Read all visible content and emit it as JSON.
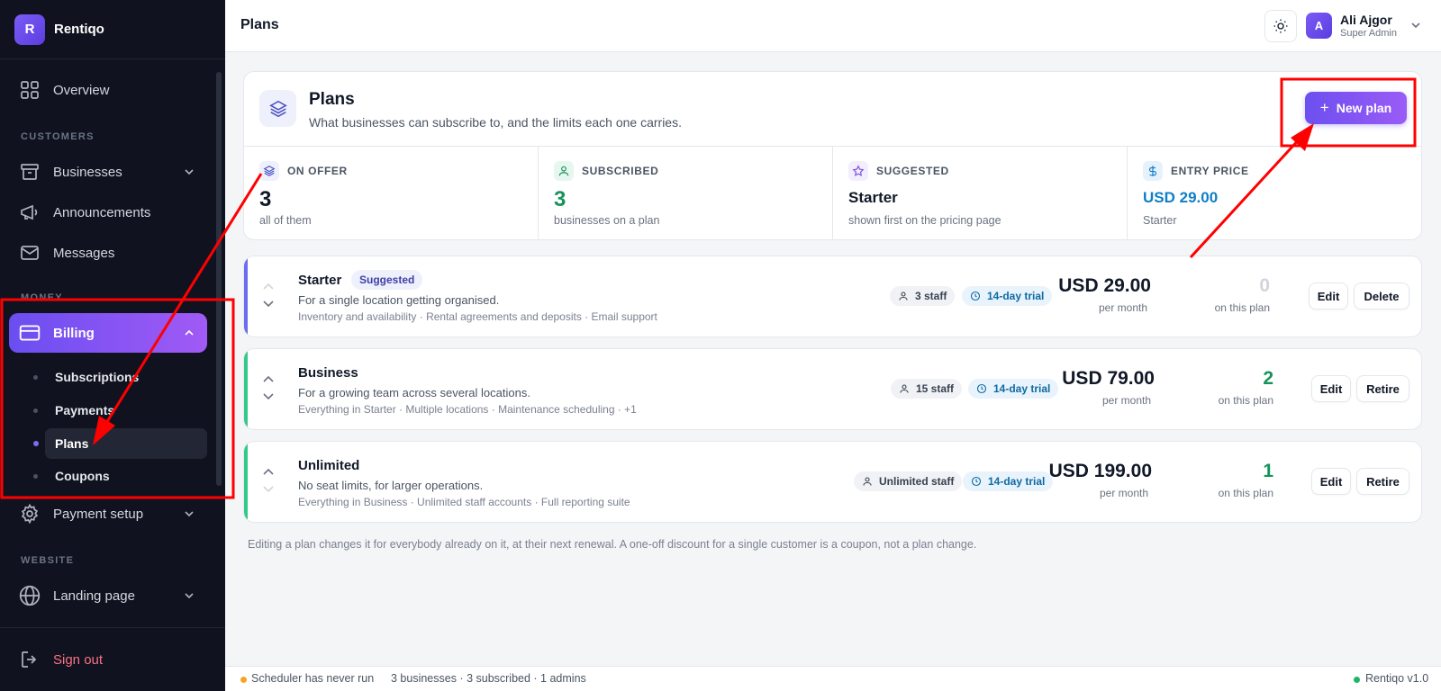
{
  "brand": {
    "logo_letter": "R",
    "name": "Rentiqo"
  },
  "sidebar": {
    "overview": "Overview",
    "section_customers": "CUSTOMERS",
    "businesses": "Businesses",
    "announcements": "Announcements",
    "messages": "Messages",
    "section_money": "MONEY",
    "billing": "Billing",
    "sub_items": [
      "Subscriptions",
      "Payments",
      "Plans",
      "Coupons"
    ],
    "payment_setup": "Payment setup",
    "section_website": "WEBSITE",
    "landing_page": "Landing page",
    "sign_out": "Sign out"
  },
  "topbar": {
    "title": "Plans",
    "user_initial": "A",
    "user_name": "Ali Ajgor",
    "user_role": "Super Admin"
  },
  "header": {
    "title": "Plans",
    "subtitle": "What businesses can subscribe to, and the limits each one carries.",
    "new_plan_label": "New plan"
  },
  "stats": [
    {
      "label": "ON OFFER",
      "value": "3",
      "note": "all of them",
      "icon": "layers-icon"
    },
    {
      "label": "SUBSCRIBED",
      "value": "3",
      "note": "businesses on a plan",
      "icon": "user-icon"
    },
    {
      "label": "SUGGESTED",
      "value": "Starter",
      "note": "shown first on the pricing page",
      "icon": "star-icon"
    },
    {
      "label": "ENTRY PRICE",
      "value": "USD 29.00",
      "note": "Starter",
      "icon": "dollar-icon"
    }
  ],
  "plans": [
    {
      "name": "Starter",
      "badge": "Suggested",
      "description": "For a single location getting organised.",
      "features": "Inventory and availability · Rental agreements and deposits · Email support",
      "staff": "3 staff",
      "trial": "14-day trial",
      "price": "USD 29.00",
      "period": "per month",
      "count": "0",
      "count_note": "on this plan",
      "edit": "Edit",
      "action": "Delete"
    },
    {
      "name": "Business",
      "badge": "",
      "description": "For a growing team across several locations.",
      "features": "Everything in Starter · Multiple locations · Maintenance scheduling · +1",
      "staff": "15 staff",
      "trial": "14-day trial",
      "price": "USD 79.00",
      "period": "per month",
      "count": "2",
      "count_note": "on this plan",
      "edit": "Edit",
      "action": "Retire"
    },
    {
      "name": "Unlimited",
      "badge": "",
      "description": "No seat limits, for larger operations.",
      "features": "Everything in Business · Unlimited staff accounts · Full reporting suite",
      "staff": "Unlimited staff",
      "trial": "14-day trial",
      "price": "USD 199.00",
      "period": "per month",
      "count": "1",
      "count_note": "on this plan",
      "edit": "Edit",
      "action": "Retire"
    }
  ],
  "footnote": "Editing a plan changes it for everybody already on it, at their next renewal. A one-off discount for a single customer is a coupon, not a plan change.",
  "statusbar": {
    "scheduler": "Scheduler has never run",
    "summary": "3 businesses · 3 subscribed · 1 admins",
    "version": "Rentiqo v1.0"
  },
  "colors": {
    "accent": "#6d4ff0",
    "starter_accent": "#6b6cf0",
    "plan_accent": "#34c98a",
    "subscribed_value": "#16935b",
    "entry_price_value": "#0e7fc6",
    "sign_out": "#f87183",
    "annotation": "#ff0000"
  }
}
